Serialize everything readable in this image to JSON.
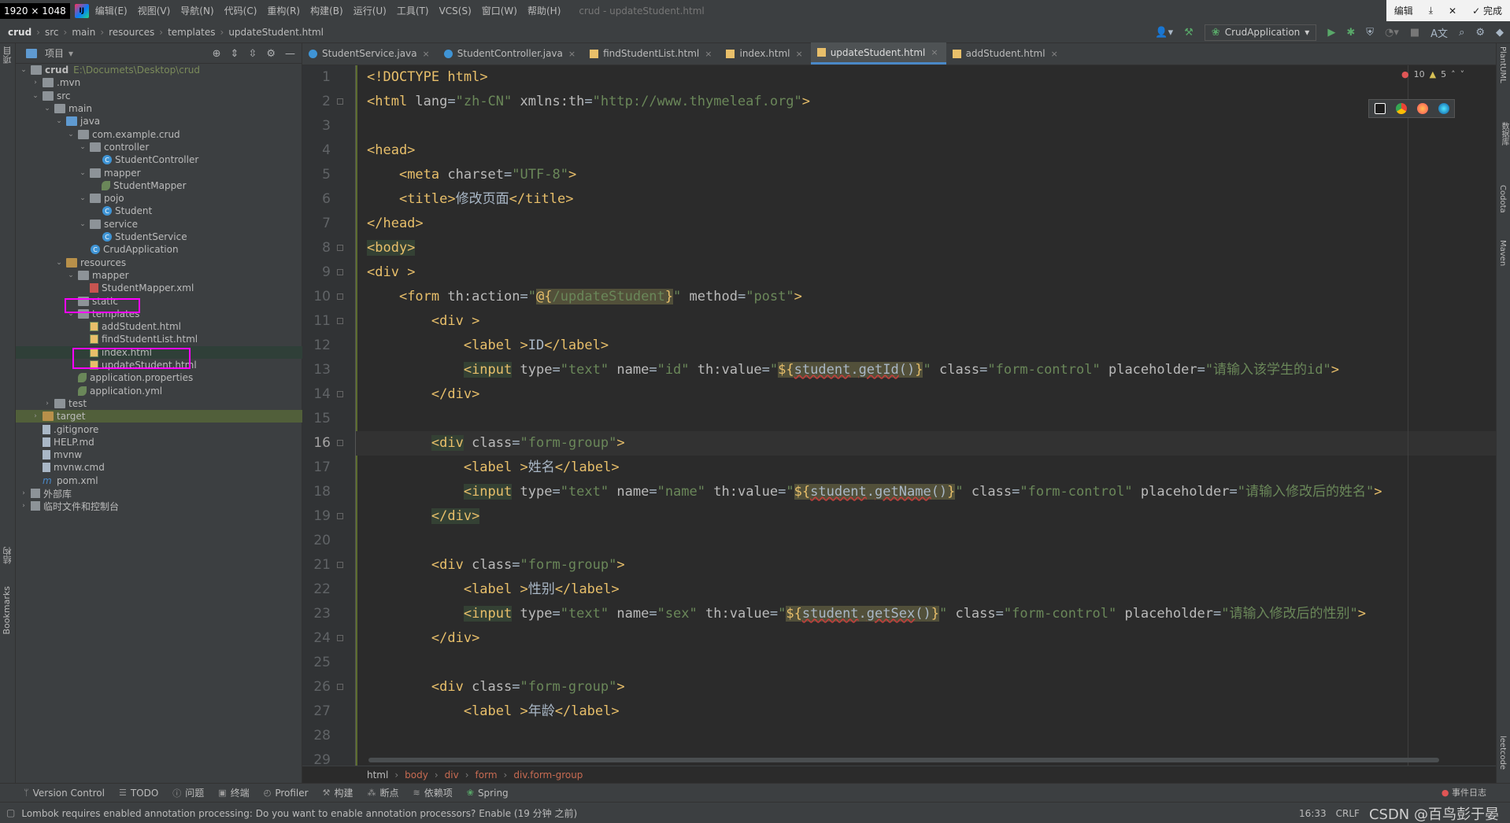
{
  "screen_dim": "1920 × 1048",
  "menubar": {
    "items": [
      "编辑(E)",
      "视图(V)",
      "导航(N)",
      "代码(C)",
      "重构(R)",
      "构建(B)",
      "运行(U)",
      "工具(T)",
      "VCS(S)",
      "窗口(W)",
      "帮助(H)"
    ],
    "file_title": "crud - updateStudent.html",
    "win_edit": "编辑",
    "win_done": "完成"
  },
  "navbar": {
    "crumbs": [
      "crud",
      "src",
      "main",
      "resources",
      "templates",
      "updateStudent.html"
    ],
    "run_config": "CrudApplication"
  },
  "project": {
    "title": "项目",
    "tree": [
      {
        "label": "crud",
        "path": "E:\\Documets\\Desktop\\crud",
        "depth": 0,
        "arrow": "open",
        "icon": "folder"
      },
      {
        "label": ".mvn",
        "depth": 1,
        "arrow": "closed",
        "icon": "folder"
      },
      {
        "label": "src",
        "depth": 1,
        "arrow": "open",
        "icon": "folder"
      },
      {
        "label": "main",
        "depth": 2,
        "arrow": "open",
        "icon": "folder"
      },
      {
        "label": "java",
        "depth": 3,
        "arrow": "open",
        "icon": "folder-blue"
      },
      {
        "label": "com.example.crud",
        "depth": 4,
        "arrow": "open",
        "icon": "folder"
      },
      {
        "label": "controller",
        "depth": 5,
        "arrow": "open",
        "icon": "folder"
      },
      {
        "label": "StudentController",
        "depth": 6,
        "arrow": "",
        "icon": "class"
      },
      {
        "label": "mapper",
        "depth": 5,
        "arrow": "open",
        "icon": "folder"
      },
      {
        "label": "StudentMapper",
        "depth": 6,
        "arrow": "",
        "icon": "leaf"
      },
      {
        "label": "pojo",
        "depth": 5,
        "arrow": "open",
        "icon": "folder"
      },
      {
        "label": "Student",
        "depth": 6,
        "arrow": "",
        "icon": "class"
      },
      {
        "label": "service",
        "depth": 5,
        "arrow": "open",
        "icon": "folder"
      },
      {
        "label": "StudentService",
        "depth": 6,
        "arrow": "",
        "icon": "class"
      },
      {
        "label": "CrudApplication",
        "depth": 5,
        "arrow": "",
        "icon": "class"
      },
      {
        "label": "resources",
        "depth": 3,
        "arrow": "open",
        "icon": "folder-orange"
      },
      {
        "label": "mapper",
        "depth": 4,
        "arrow": "open",
        "icon": "folder"
      },
      {
        "label": "StudentMapper.xml",
        "depth": 5,
        "arrow": "",
        "icon": "xml"
      },
      {
        "label": "static",
        "depth": 4,
        "arrow": "",
        "icon": "folder"
      },
      {
        "label": "templates",
        "depth": 4,
        "arrow": "open",
        "icon": "folder"
      },
      {
        "label": "addStudent.html",
        "depth": 5,
        "arrow": "",
        "icon": "html"
      },
      {
        "label": "findStudentList.html",
        "depth": 5,
        "arrow": "",
        "icon": "html"
      },
      {
        "label": "index.html",
        "depth": 5,
        "arrow": "",
        "icon": "html"
      },
      {
        "label": "updateStudent.html",
        "depth": 5,
        "arrow": "",
        "icon": "html"
      },
      {
        "label": "application.properties",
        "depth": 4,
        "arrow": "",
        "icon": "leaf"
      },
      {
        "label": "application.yml",
        "depth": 4,
        "arrow": "",
        "icon": "leaf"
      },
      {
        "label": "test",
        "depth": 2,
        "arrow": "closed",
        "icon": "folder"
      },
      {
        "label": "target",
        "depth": 1,
        "arrow": "closed",
        "icon": "folder-orange"
      },
      {
        "label": ".gitignore",
        "depth": 1,
        "arrow": "",
        "icon": "file"
      },
      {
        "label": "HELP.md",
        "depth": 1,
        "arrow": "",
        "icon": "file"
      },
      {
        "label": "mvnw",
        "depth": 1,
        "arrow": "",
        "icon": "file"
      },
      {
        "label": "mvnw.cmd",
        "depth": 1,
        "arrow": "",
        "icon": "file"
      },
      {
        "label": "pom.xml",
        "depth": 1,
        "arrow": "",
        "icon": "m"
      },
      {
        "label": "外部库",
        "depth": 0,
        "arrow": "closed",
        "icon": "lib"
      },
      {
        "label": "临时文件和控制台",
        "depth": 0,
        "arrow": "closed",
        "icon": "lib"
      }
    ]
  },
  "tabs": [
    {
      "label": "StudentService.java",
      "type": "java"
    },
    {
      "label": "StudentController.java",
      "type": "java"
    },
    {
      "label": "findStudentList.html",
      "type": "html"
    },
    {
      "label": "index.html",
      "type": "html"
    },
    {
      "label": "updateStudent.html",
      "type": "html",
      "active": true
    },
    {
      "label": "addStudent.html",
      "type": "html"
    }
  ],
  "editor": {
    "line_numbers": [
      "1",
      "2",
      "3",
      "4",
      "5",
      "6",
      "7",
      "8",
      "9",
      "10",
      "11",
      "12",
      "13",
      "14",
      "15",
      "16",
      "17",
      "18",
      "19",
      "20",
      "21",
      "22",
      "23",
      "24",
      "25",
      "26",
      "27",
      "28",
      "29"
    ],
    "current_line": "16",
    "inspections": {
      "errors": "10",
      "warnings": "5"
    }
  },
  "editor_crumbs": [
    "html",
    "body",
    "div",
    "form",
    "div.form-group"
  ],
  "bottom_tools": [
    "Version Control",
    "TODO",
    "问题",
    "终端",
    "Profiler",
    "构建",
    "断点",
    "依赖项",
    "Spring"
  ],
  "event_log": "事件日志",
  "left_stripe": [
    "项目",
    "结构",
    "Bookmarks"
  ],
  "right_stripe": [
    "PlantUML",
    "数据库",
    "Codota",
    "Maven",
    "leetcode"
  ],
  "status": {
    "message": "Lombok requires enabled annotation processing: Do you want to enable annotation processors? Enable (19 分钟 之前)",
    "position": "16:33",
    "line_sep": "CRLF",
    "watermark": "CSDN @百鸟彭于晏"
  }
}
